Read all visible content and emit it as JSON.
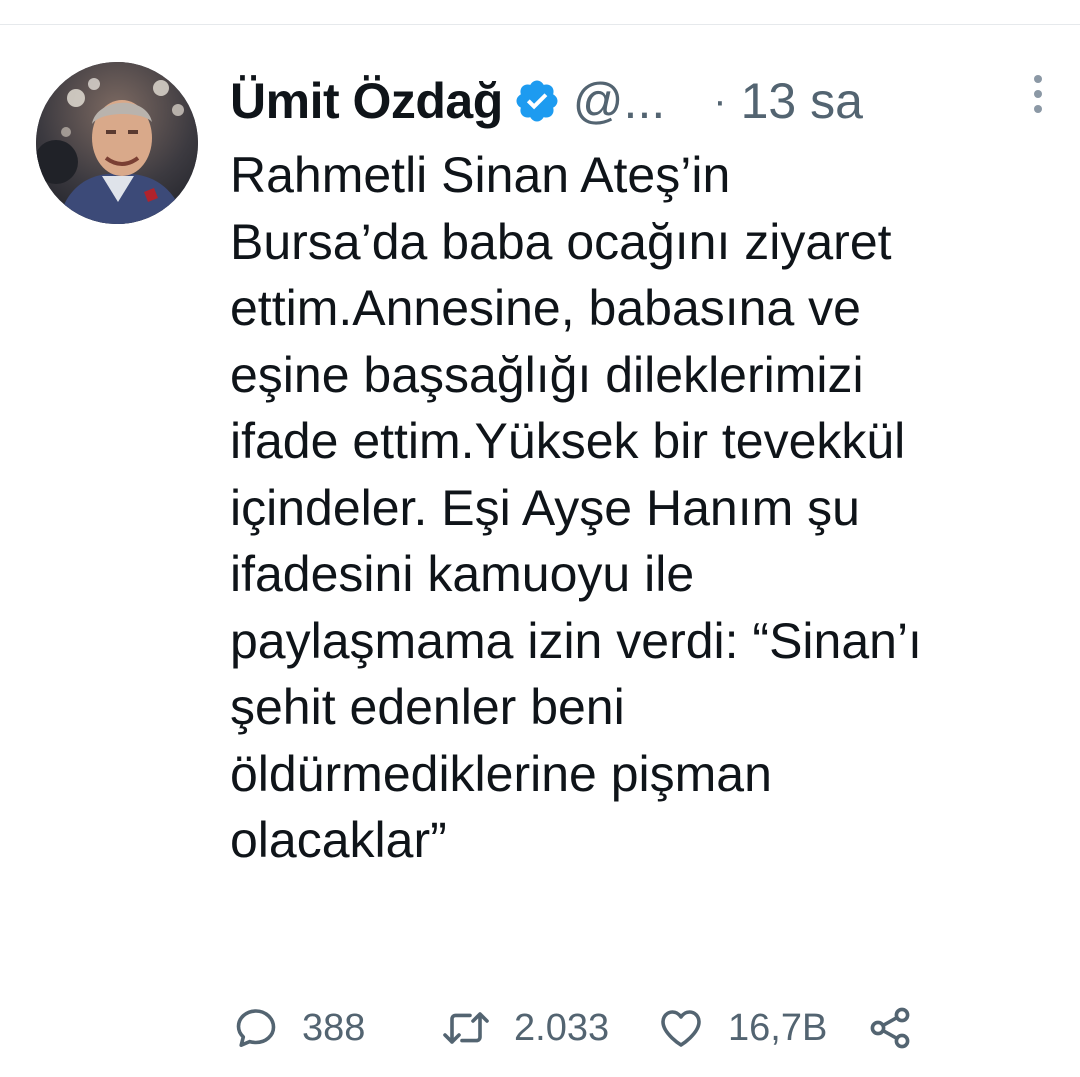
{
  "tweet": {
    "author_name": "Ümit Özdağ",
    "author_handle": "@...",
    "separator": "·",
    "time": "13 sa",
    "body_lines": [
      "Rahmetli Sinan Ateş’in",
      "Bursa’da baba ocağını ziyaret",
      "ettim.Annesine, babasına ve",
      "eşine başsağlığı dileklerimizi",
      "ifade ettim.Yüksek bir tevekkül",
      "içindeler. Eşi Ayşe Hanım şu",
      "ifadesini kamuoyu ile",
      "paylaşmama izin verdi: “Sinan’ı",
      "şehit edenler beni",
      "öldürmediklerine pişman",
      "olacaklar”"
    ],
    "stats": {
      "replies": "388",
      "retweets": "2.033",
      "likes": "16,7B"
    }
  },
  "icons": {
    "verified": "verified-badge-icon",
    "more": "more-vertical-icon",
    "reply": "reply-icon",
    "retweet": "retweet-icon",
    "like": "heart-icon",
    "share": "share-icon"
  },
  "colors": {
    "text_primary": "#0f1419",
    "text_secondary": "#536471",
    "verified_blue": "#1d9bf0",
    "divider": "#e6e9ec"
  }
}
